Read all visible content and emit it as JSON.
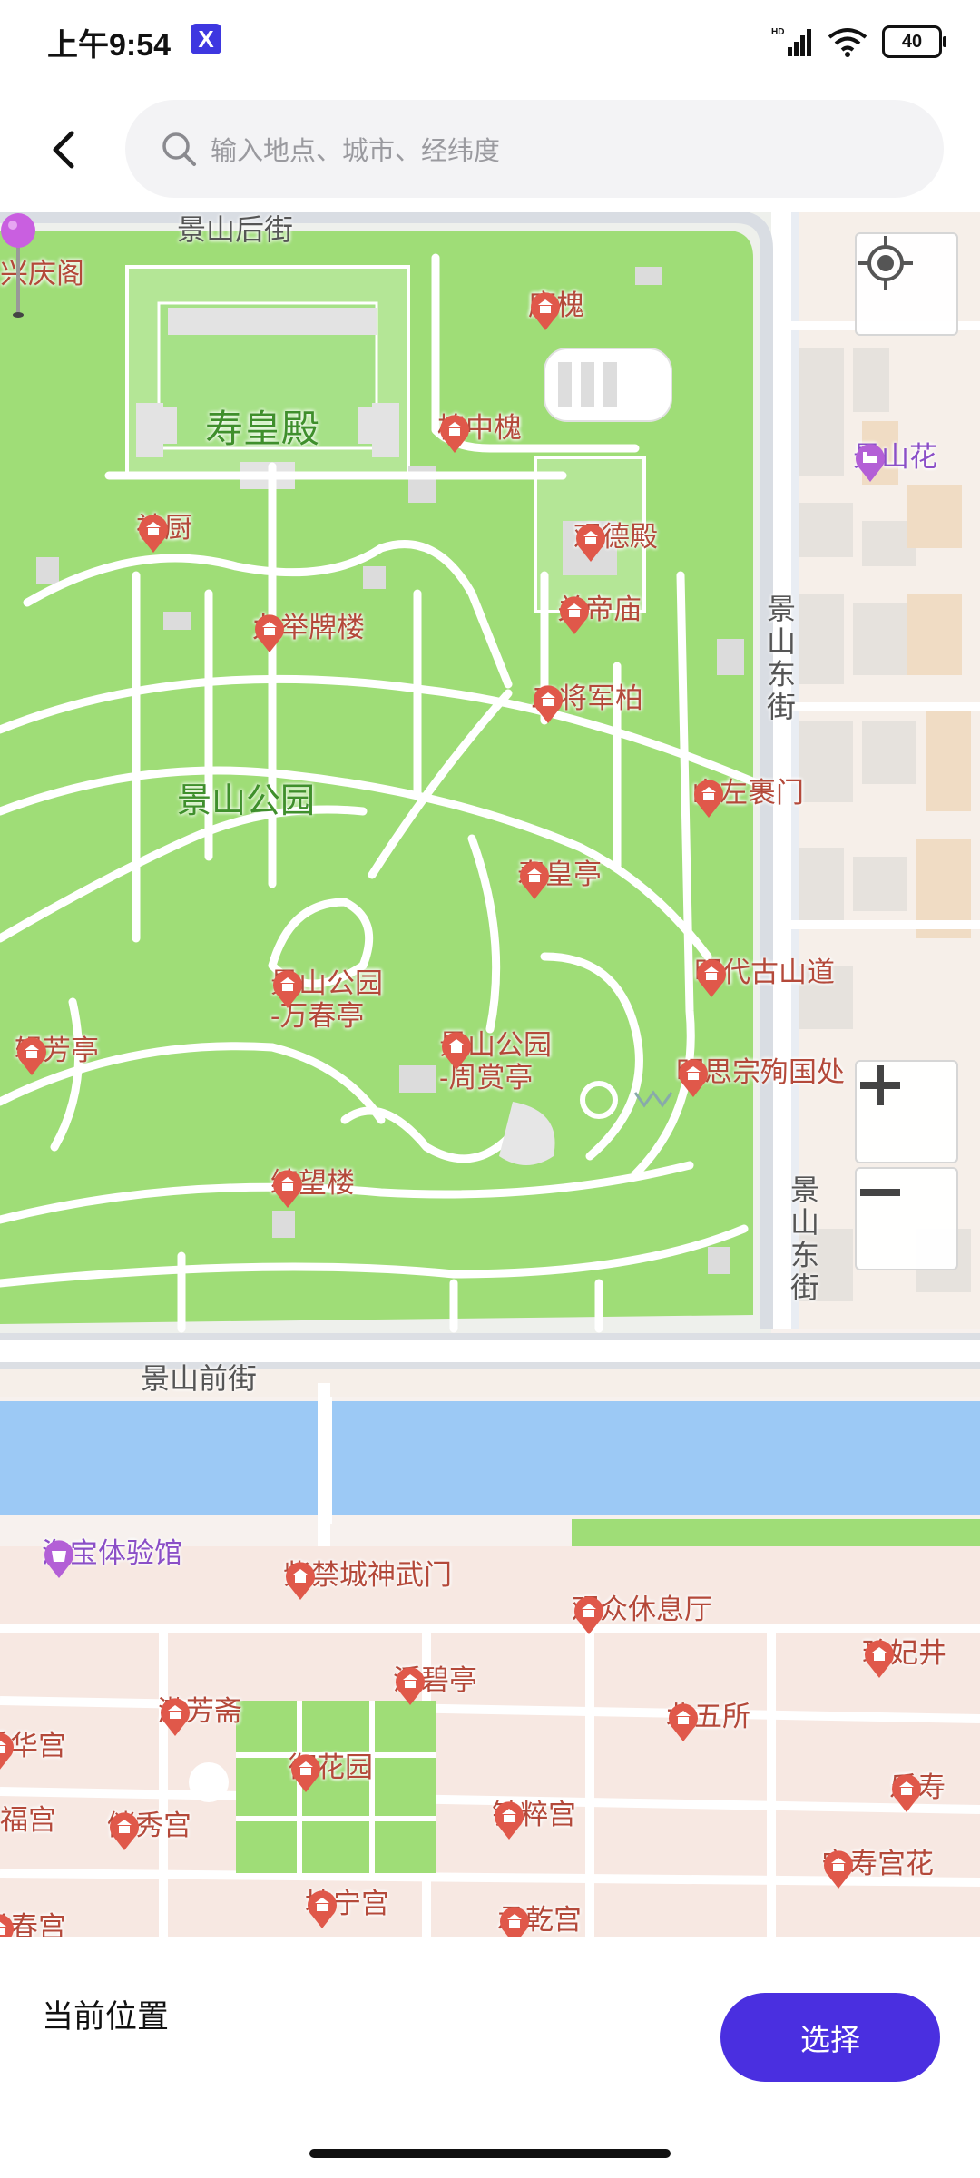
{
  "status_bar": {
    "time": "上午9:54",
    "badge": "X",
    "network": "HD",
    "battery": "40"
  },
  "header": {
    "search_placeholder": "输入地点、城市、经纬度"
  },
  "map": {
    "park_labels": [
      "寿皇殿",
      "景山公园"
    ],
    "street_labels": [
      "景山后街",
      "景山东街",
      "景山东街",
      "景山前街"
    ],
    "pois": [
      {
        "name": "兴庆阁",
        "style": "red-noicon"
      },
      {
        "name": "唐槐",
        "style": "red"
      },
      {
        "name": "槐中槐",
        "style": "red"
      },
      {
        "name": "神厨",
        "style": "red"
      },
      {
        "name": "观德殿",
        "style": "red"
      },
      {
        "name": "关帝庙",
        "style": "red-left"
      },
      {
        "name": "九举牌楼",
        "style": "red"
      },
      {
        "name": "二将军柏",
        "style": "red-left"
      },
      {
        "name": "山左裹门",
        "style": "red"
      },
      {
        "name": "寿皇亭",
        "style": "red"
      },
      {
        "name": "明代古山道",
        "style": "red"
      },
      {
        "name": "景山公园\n-万春亭",
        "style": "red"
      },
      {
        "name": "辑芳亭",
        "style": "red-left"
      },
      {
        "name": "景山公园\n-周赏亭",
        "style": "red-left"
      },
      {
        "name": "明思宗殉国处",
        "style": "red"
      },
      {
        "name": "绮望楼",
        "style": "red"
      },
      {
        "name": "景山花",
        "style": "purple"
      },
      {
        "name": "淘宝体验馆",
        "style": "purple-left"
      },
      {
        "name": "紫禁城神武门",
        "style": "red"
      },
      {
        "name": "观众休息厅",
        "style": "red-left"
      },
      {
        "name": "珍妃井",
        "style": "red"
      },
      {
        "name": "浮碧亭",
        "style": "red"
      },
      {
        "name": "漱芳斋",
        "style": "red"
      },
      {
        "name": "北五所",
        "style": "red"
      },
      {
        "name": "重华宫",
        "style": "red"
      },
      {
        "name": "御花园",
        "style": "red"
      },
      {
        "name": "福宫",
        "style": "red-noicon"
      },
      {
        "name": "储秀宫",
        "style": "red"
      },
      {
        "name": "钟粹宫",
        "style": "red"
      },
      {
        "name": "乐寿",
        "style": "red"
      },
      {
        "name": "宁寿宫花",
        "style": "red"
      },
      {
        "name": "坤宁宫",
        "style": "red"
      },
      {
        "name": "承乾宫",
        "style": "red"
      },
      {
        "name": "长春宫",
        "style": "red"
      }
    ],
    "controls": {
      "zoom_in": "+",
      "zoom_out": "−"
    }
  },
  "bottom_panel": {
    "current_location_label": "当前位置",
    "select_label": "选择"
  },
  "colors": {
    "accent": "#4a2fe0",
    "park_green": "#9fdd77",
    "water": "#9cc9f5",
    "poi_red": "#e0584a",
    "marker": "#c95fe0"
  }
}
